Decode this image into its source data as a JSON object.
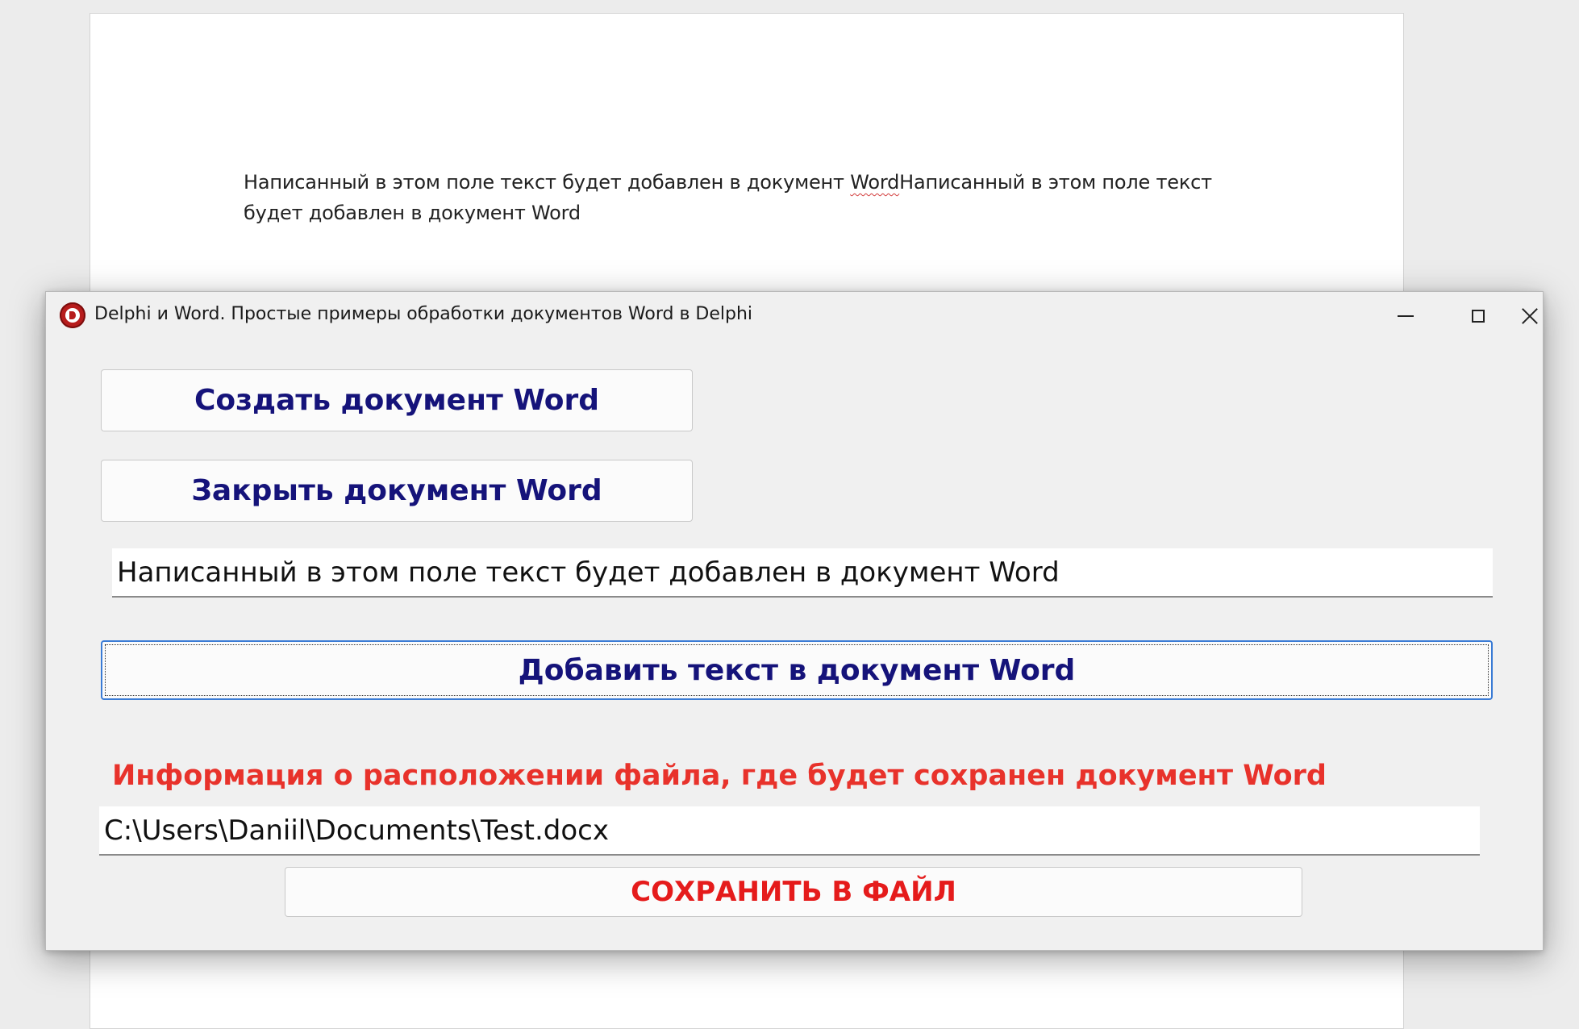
{
  "word_document": {
    "text_before_word": "Написанный в этом поле текст будет добавлен в документ ",
    "misspelled_word": "Word",
    "text_after_word": "Написанный в этом поле текст будет добавлен в документ Word"
  },
  "window": {
    "title": "Delphi и Word. Простые примеры обработки документов Word в Delphi",
    "icon": "delphi-logo-icon",
    "controls": [
      "minimize",
      "maximize",
      "close"
    ]
  },
  "form": {
    "create_button": "Создать документ Word",
    "close_button": "Закрыть документ Word",
    "text_field_value": "Написанный в этом поле текст будет добавлен в документ Word",
    "add_text_button": "Добавить текст в документ Word",
    "info_label": "Информация о расположении файла, где будет сохранен документ Word",
    "path_field_value": "C:\\Users\\Daniil\\Documents\\Test.docx",
    "save_button": "СОХРАНИТЬ В ФАЙЛ"
  },
  "colors": {
    "button_text": "#15137a",
    "warning_text": "#e8322b",
    "save_button_text": "#e51b1b",
    "icon_red": "#b71c1c"
  }
}
